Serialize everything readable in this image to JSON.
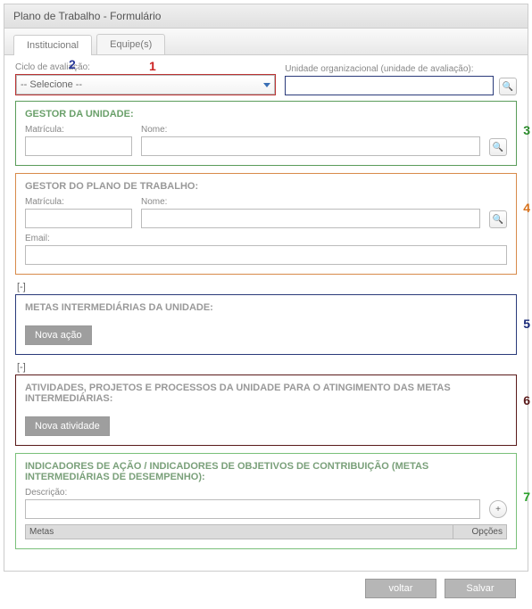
{
  "title": "Plano de Trabalho - Formulário",
  "tabs": {
    "institucional": "Institucional",
    "equipes": "Equipe(s)"
  },
  "annotations": {
    "a1": "1",
    "a2": "2",
    "a3": "3",
    "a4": "4",
    "a5": "5",
    "a6": "6",
    "a7": "7"
  },
  "fields": {
    "ciclo_label": "Ciclo de avaliação:",
    "ciclo_selected": "-- Selecione --",
    "unidade_label": "Unidade organizacional (unidade de avaliação):",
    "unidade_value": ""
  },
  "gestor_unidade": {
    "title": "GESTOR DA UNIDADE:",
    "matricula_label": "Matrícula:",
    "matricula_value": "",
    "nome_label": "Nome:",
    "nome_value": ""
  },
  "gestor_plano": {
    "title": "GESTOR DO PLANO DE TRABALHO:",
    "matricula_label": "Matrícula:",
    "matricula_value": "",
    "nome_label": "Nome:",
    "nome_value": "",
    "email_label": "Email:",
    "email_value": ""
  },
  "collapse": "[-]",
  "metas": {
    "title": "METAS INTERMEDIÁRIAS DA UNIDADE:",
    "btn": "Nova ação"
  },
  "atividades": {
    "title": "ATIVIDADES, PROJETOS E PROCESSOS DA UNIDADE PARA O ATINGIMENTO DAS METAS INTERMEDIÁRIAS:",
    "btn": "Nova atividade"
  },
  "indicadores": {
    "title": "INDICADORES DE AÇÃO / INDICADORES DE OBJETIVOS DE CONTRIBUIÇÃO (METAS INTERMEDIÁRIAS DE DESEMPENHO):",
    "descricao_label": "Descrição:",
    "descricao_value": "",
    "hdr_metas": "Metas",
    "hdr_opcoes": "Opções"
  },
  "footer": {
    "voltar": "voltar",
    "salvar": "Salvar"
  },
  "icons": {
    "search": "🔍",
    "plus": "+"
  }
}
